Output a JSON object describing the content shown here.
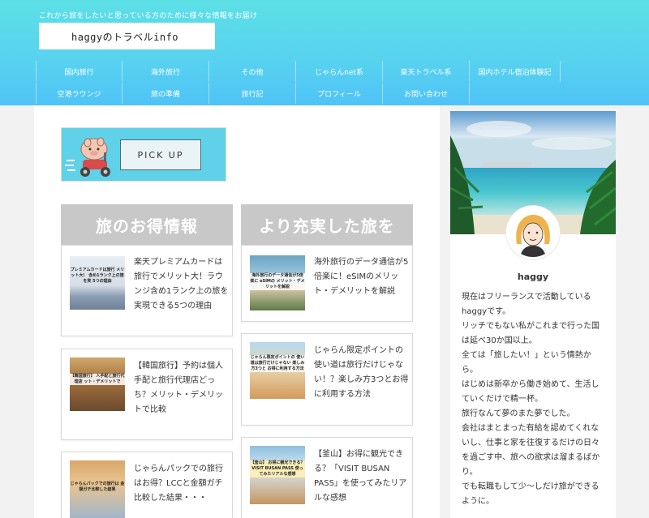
{
  "header": {
    "tagline": "これから旅をしたいと思っている方のために様々な情報をお届け",
    "logo": "haggyのトラベルinfo",
    "colors": {
      "gradient_top": "#5ce0e6",
      "gradient_bottom": "#4fc3f7"
    }
  },
  "nav": {
    "row1": [
      "国内旅行",
      "海外旅行",
      "その他",
      "じゃらんnet系",
      "楽天トラベル系",
      "国内ホテル宿泊体験記"
    ],
    "row2": [
      "空港ラウンジ",
      "旅の準備",
      "旅行記",
      "プロフィール",
      "お問い合わせ"
    ]
  },
  "pickup": {
    "label": "PICK UP"
  },
  "columns": {
    "left": {
      "heading": "旅のお得情報",
      "cards": [
        {
          "title": "楽天プレミアムカードは旅行でメリット大！ラウンジ含め1ランク上の旅を実現できる5つの理由",
          "thumb_text": "プレミアムカードは旅行 メリット大！ 含め1ランク上の旅を実 5つの理由"
        },
        {
          "title": "【韓国旅行】予約は個人手配と旅行代理店どっち？メリット・デメリットで比較",
          "thumb_text": "【韓国旅行】 人手配と旅行代理店 ット・デメリットで"
        },
        {
          "title": "じゃらんパックでの旅行はお得？LCCと金額ガチ比較した結果・・・",
          "thumb_text": "じゃらんパックでの旅行は 金額ガチ比較した結果"
        }
      ]
    },
    "right": {
      "heading": "より充実した旅を",
      "cards": [
        {
          "title": "海外旅行のデータ通信が5倍楽に！eSIMのメリット・デメリットを解説",
          "thumb_text": "海外旅行のデータ通信が5倍楽に eSIMの メリット・デメリットを解説"
        },
        {
          "title": "じゃらん限定ポイントの使い道は旅行だけじゃない！？楽しみ方3つとお得に利用する方法",
          "thumb_text": "じゃらん限定ポイントの 使い道は旅行だけじゃない 楽しみ方3つと お得に利用する方法"
        },
        {
          "title": "【釜山】お得に観光できる？「VISIT BUSAN PASS」を使ってみたリアルな感想",
          "thumb_text": "【釜山】 お得に観光できる？ VISIT BUSAN PASS 使ってみたリアルな感想"
        }
      ]
    }
  },
  "sidebar": {
    "name": "haggy",
    "bio": [
      "現在はフリーランスで活動している",
      "haggyです。",
      "リッチでもない私がこれまで行った国",
      "は延べ30か国以上。",
      "全ては「旅したい！」という情熱か",
      "ら。",
      "はじめは新卒から働き始めて、生活し",
      "ていくだけで精一杯。",
      "旅行なんて夢のまた夢でした。",
      "会社はまとまった有給を認めてくれな",
      "いし、仕事と家を往復するだけの日々",
      "を過ごす中、旅への欲求は溜まるばか",
      "り。",
      "でも転職もして少～しだけ旅ができる",
      "ように。"
    ]
  }
}
